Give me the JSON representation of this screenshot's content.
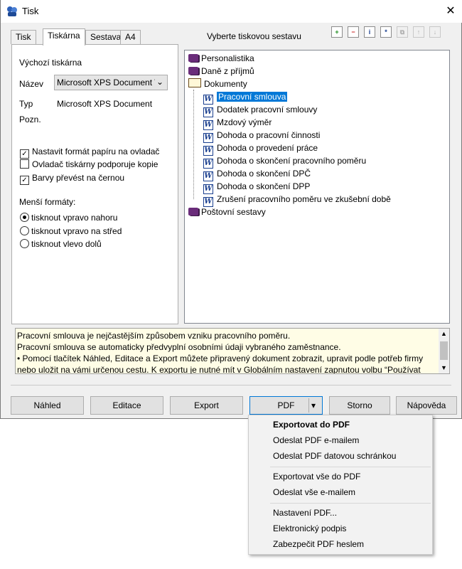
{
  "window": {
    "title": "Tisk",
    "close": "✕"
  },
  "tabs": [
    "Tisk",
    "Tiskárna",
    "Sestava",
    "A4"
  ],
  "printer": {
    "section_title": "Výchozí tiskárna",
    "name_label": "Název",
    "name_value": "Microsoft XPS Document Writer",
    "type_label": "Typ",
    "type_value": "Microsoft XPS Document",
    "note_label": "Pozn.",
    "checkboxes": [
      {
        "label": "Nastavit formát papíru na ovladač",
        "checked": true
      },
      {
        "label": "Ovladač tiskárny podporuje kopie",
        "checked": false
      },
      {
        "label": "Barvy převést na černou",
        "checked": true
      }
    ],
    "smaller_formats_label": "Menší formáty:",
    "radios": [
      {
        "label": "tisknout vpravo nahoru",
        "checked": true
      },
      {
        "label": "tisknout vpravo na střed",
        "checked": false
      },
      {
        "label": "tisknout vlevo dolů",
        "checked": false
      }
    ]
  },
  "tree": {
    "header": "Vyberte tiskovou sestavu",
    "toolbar_icons": [
      "add-icon",
      "remove-icon",
      "info-icon",
      "properties-icon",
      "copy-icon",
      "move-up-icon",
      "move-down-icon"
    ],
    "top_nodes": [
      "Personalistika",
      "Daně z příjmů",
      "Dokumenty"
    ],
    "documents": [
      "Pracovní smlouva",
      "Dodatek pracovní smlouvy",
      "Mzdový výměr",
      "Dohoda o pracovní činnosti",
      "Dohoda o provedení práce",
      "Dohoda o skončení pracovního poměru",
      "Dohoda o skončení DPČ",
      "Dohoda o skončení DPP",
      "Zrušení pracovního poměru ve zkušební době"
    ],
    "selected": "Pracovní smlouva",
    "last_node": "Poštovní sestavy"
  },
  "description": {
    "line1": "Pracovní smlouva je nejčastějším způsobem vzniku pracovního poměru.",
    "line2": "Pracovní smlouva se automaticky předvyplní osobními údaji vybraného zaměstnance.",
    "line3": "• Pomocí tlačítek Náhled, Editace a Export můžete připravený dokument zobrazit, upravit podle potřeb firmy",
    "line4": "nebo uložit na vámi určenou cestu. K exportu je nutné mít v Globálním nastavení zapnutou volbu “Používat"
  },
  "buttons": {
    "preview": "Náhled",
    "edit": "Editace",
    "export": "Export",
    "pdf": "PDF",
    "pdf_arrow": "▾",
    "cancel": "Storno",
    "help": "Nápověda"
  },
  "pdf_menu": [
    "Exportovat do PDF",
    "Odeslat PDF e-mailem",
    "Odeslat PDF datovou schránkou",
    "Exportovat vše do PDF",
    "Odeslat vše e-mailem",
    "Nastavení PDF...",
    "Elektronický podpis",
    "Zabezpečit PDF heslem"
  ]
}
